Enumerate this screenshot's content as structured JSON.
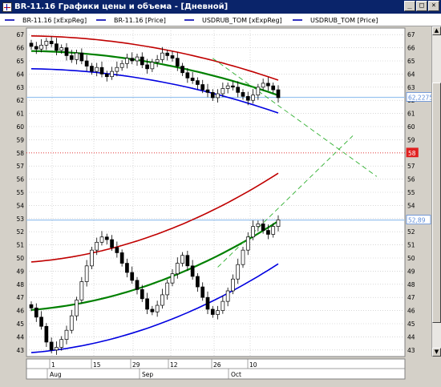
{
  "window": {
    "title": "BR-11.16 Графики цены и объема - [Дневной]",
    "buttons": [
      "_",
      "□",
      "×"
    ]
  },
  "legend": [
    {
      "label": "BR-11.16 [xExpReg]",
      "color": "#3030c0"
    },
    {
      "label": "BR-11.16 [Price]",
      "color": "#3030c0"
    },
    {
      "label": "USDRUB_TOM [xExpReg]",
      "color": "#3030c0"
    },
    {
      "label": "USDRUB_TOM [Price]",
      "color": "#3030c0"
    }
  ],
  "axis": {
    "y_ticks": [
      "67",
      "66",
      "65",
      "64",
      "63",
      "62",
      "61",
      "60",
      "59",
      "58",
      "57",
      "56",
      "55",
      "54",
      "53",
      "52",
      "51",
      "50",
      "49",
      "48",
      "47",
      "46",
      "45",
      "44",
      "43"
    ],
    "x_ticks": [
      "1",
      "15",
      "29",
      "12",
      "26",
      "10"
    ],
    "months": [
      "Aug",
      "Sep",
      "Oct"
    ]
  },
  "price_labels": [
    {
      "text": "62,2275",
      "color": "#5a8ad8",
      "fill": "#ffffff"
    },
    {
      "text": "58",
      "color": "#ffffff",
      "fill": "#e02020"
    },
    {
      "text": "52,89",
      "color": "#5a8ad8",
      "fill": "#ffffff"
    }
  ],
  "colors": {
    "red_band": "#c00000",
    "green_reg": "#008000",
    "blue_band": "#0000e0",
    "hline_blue": "#9ac4f0",
    "hline_red": "#e02020",
    "grid": "#c0c0c0",
    "proj": "#30b030"
  },
  "chart_data": {
    "type": "line",
    "ylim": [
      42.5,
      67.5
    ],
    "grid": true,
    "series": [
      {
        "name": "BR-11.16 [Price]",
        "type": "candlestick",
        "values": [
          66.1,
          65.9,
          66.2,
          66.5,
          66.3,
          65.8,
          66.0,
          65.4,
          65.1,
          65.6,
          65.0,
          64.6,
          64.2,
          64.5,
          64.0,
          63.8,
          64.2,
          64.5,
          64.8,
          65.2,
          65.0,
          65.3,
          64.7,
          64.4,
          64.9,
          65.1,
          65.6,
          65.4,
          65.2,
          64.6,
          64.1,
          63.7,
          63.5,
          63.2,
          62.8,
          62.6,
          62.2,
          62.5,
          62.9,
          63.1,
          63.0,
          62.6,
          62.3,
          62.0,
          62.4,
          63.0,
          63.3,
          63.1,
          62.8,
          62.2
        ]
      },
      {
        "name": "USDRUB_TOM [Price]",
        "type": "candlestick",
        "values": [
          46.2,
          45.5,
          44.8,
          43.6,
          43.0,
          43.2,
          43.8,
          44.5,
          45.6,
          46.8,
          48.2,
          49.4,
          50.6,
          51.2,
          51.6,
          51.4,
          50.8,
          50.4,
          49.6,
          48.9,
          48.3,
          47.6,
          46.9,
          46.1,
          45.9,
          46.4,
          47.2,
          48.1,
          48.8,
          49.6,
          50.2,
          49.4,
          48.6,
          47.8,
          47.0,
          46.1,
          45.7,
          46.0,
          46.7,
          47.5,
          48.4,
          49.5,
          50.6,
          51.6,
          52.4,
          52.6,
          52.1,
          51.8,
          52.4,
          52.9
        ]
      }
    ]
  }
}
